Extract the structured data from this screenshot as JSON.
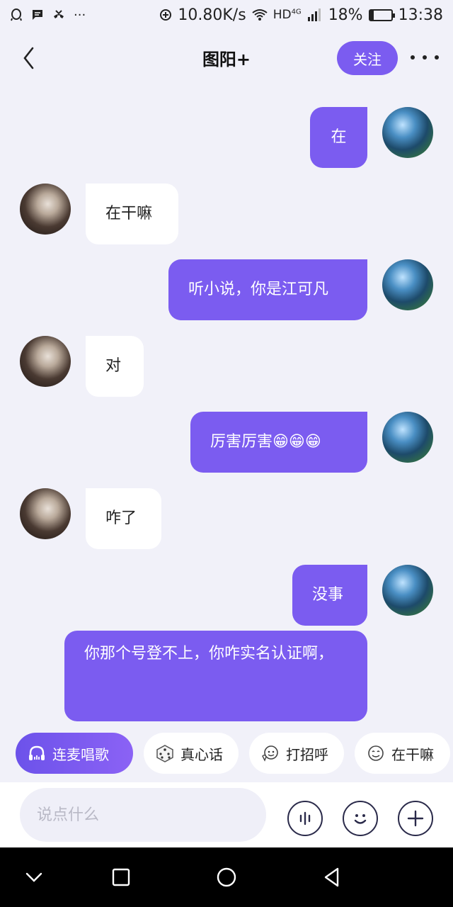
{
  "status_bar": {
    "speed": "10.80K/s",
    "network": "HD",
    "network_gen": "4G",
    "battery": "18%",
    "battery_level": 0.18,
    "time": "13:38"
  },
  "header": {
    "title": "图阳+",
    "follow_label": "关注"
  },
  "messages": [
    {
      "sender": "self",
      "text": "在"
    },
    {
      "sender": "other",
      "text": "在干嘛"
    },
    {
      "sender": "self",
      "text": "听小说，你是江可凡"
    },
    {
      "sender": "other",
      "text": "对"
    },
    {
      "sender": "self",
      "text": "厉害厉害😁😁😁"
    },
    {
      "sender": "other",
      "text": "咋了"
    },
    {
      "sender": "self",
      "text": "没事"
    },
    {
      "sender": "self",
      "text": "你那个号登不上，你咋实名认证啊，"
    }
  ],
  "quick_actions": [
    {
      "label": "连麦唱歌",
      "icon": "headphones-icon"
    },
    {
      "label": "真心话",
      "icon": "dice-icon"
    },
    {
      "label": "打招呼",
      "icon": "wave-face-icon"
    },
    {
      "label": "在干嘛",
      "icon": "smile-face-icon"
    }
  ],
  "input": {
    "placeholder": "说点什么"
  },
  "colors": {
    "accent": "#7b5cf0",
    "background": "#f1f1f9",
    "bubble_other": "#ffffff"
  }
}
